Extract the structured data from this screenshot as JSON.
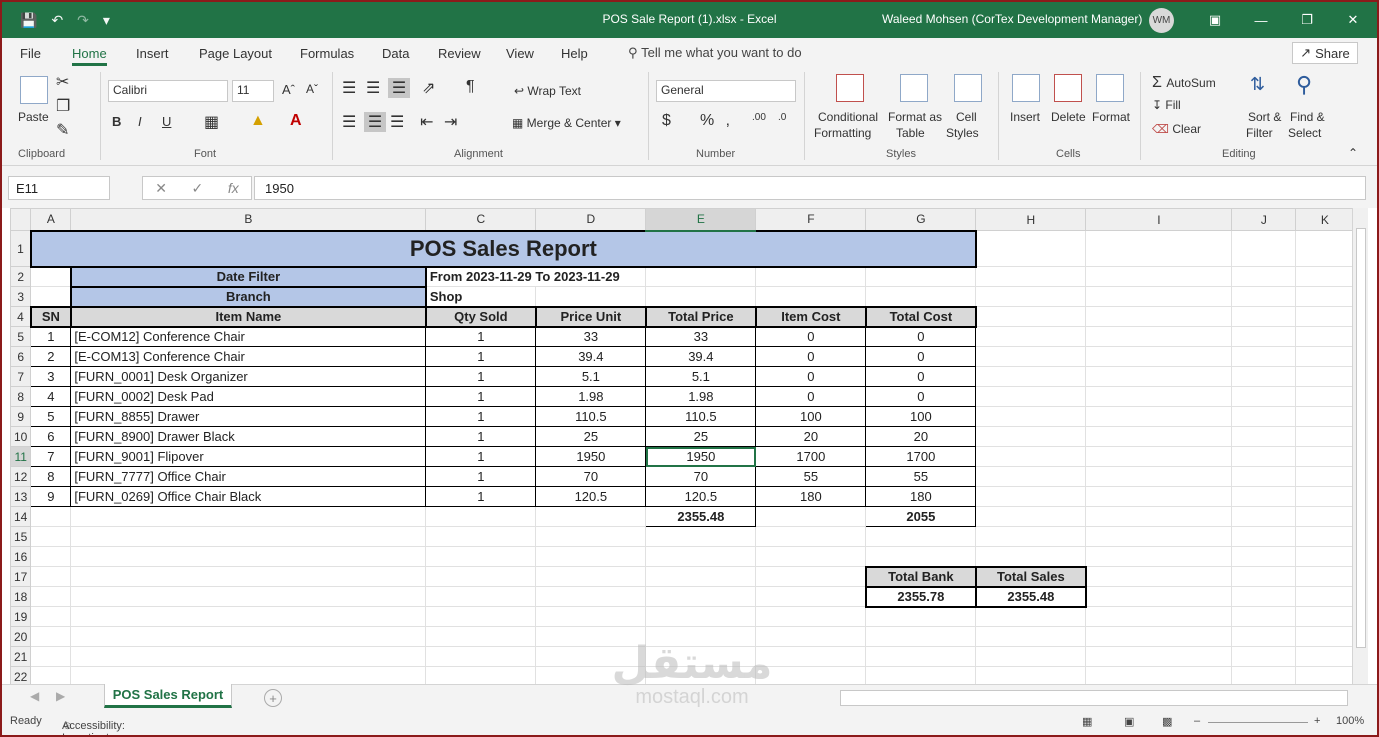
{
  "titlebar": {
    "title": "POS Sale Report (1).xlsx  -  Excel",
    "user": "Waleed Mohsen (CorTex Development Manager)",
    "avatar": "WM"
  },
  "tabs": [
    "File",
    "Home",
    "Insert",
    "Page Layout",
    "Formulas",
    "Data",
    "Review",
    "View",
    "Help"
  ],
  "tell_me": "Tell me what you want to do",
  "share": "Share",
  "ribbon": {
    "clipboard": {
      "paste": "Paste",
      "label": "Clipboard"
    },
    "font": {
      "name": "Calibri",
      "size": "11",
      "label": "Font"
    },
    "alignment": {
      "wrap": "Wrap Text",
      "merge": "Merge & Center",
      "label": "Alignment"
    },
    "number": {
      "format": "General",
      "label": "Number"
    },
    "styles": {
      "conditional": "Conditional",
      "conditional2": "Formatting",
      "format_as": "Format as",
      "format_as2": "Table",
      "cell": "Cell",
      "cell2": "Styles",
      "label": "Styles"
    },
    "cells": {
      "insert": "Insert",
      "delete": "Delete",
      "format": "Format",
      "label": "Cells"
    },
    "editing": {
      "autosum": "AutoSum",
      "fill": "Fill",
      "clear": "Clear",
      "sort": "Sort &",
      "sort2": "Filter",
      "find": "Find &",
      "find2": "Select",
      "label": "Editing"
    }
  },
  "formula_bar": {
    "name_box": "E11",
    "formula": "1950"
  },
  "columns": [
    "A",
    "B",
    "C",
    "D",
    "E",
    "F",
    "G",
    "H",
    "I",
    "J",
    "K"
  ],
  "report": {
    "title": "POS Sales Report",
    "date_filter_label": "Date Filter",
    "date_filter_value": "From 2023-11-29 To 2023-11-29",
    "branch_label": "Branch",
    "branch_value": "Shop",
    "headers": [
      "SN",
      "Item Name",
      "Qty Sold",
      "Price Unit",
      "Total Price",
      "Item Cost",
      "Total Cost"
    ],
    "rows": [
      [
        "1",
        "[E-COM12] Conference Chair",
        "1",
        "33",
        "33",
        "0",
        "0"
      ],
      [
        "2",
        "[E-COM13] Conference Chair",
        "1",
        "39.4",
        "39.4",
        "0",
        "0"
      ],
      [
        "3",
        "[FURN_0001] Desk Organizer",
        "1",
        "5.1",
        "5.1",
        "0",
        "0"
      ],
      [
        "4",
        "[FURN_0002] Desk Pad",
        "1",
        "1.98",
        "1.98",
        "0",
        "0"
      ],
      [
        "5",
        "[FURN_8855] Drawer",
        "1",
        "110.5",
        "110.5",
        "100",
        "100"
      ],
      [
        "6",
        "[FURN_8900] Drawer Black",
        "1",
        "25",
        "25",
        "20",
        "20"
      ],
      [
        "7",
        "[FURN_9001] Flipover",
        "1",
        "1950",
        "1950",
        "1700",
        "1700"
      ],
      [
        "8",
        "[FURN_7777] Office Chair",
        "1",
        "70",
        "70",
        "55",
        "55"
      ],
      [
        "9",
        "[FURN_0269] Office Chair Black",
        "1",
        "120.5",
        "120.5",
        "180",
        "180"
      ]
    ],
    "total_price": "2355.48",
    "total_cost": "2055",
    "total_bank_label": "Total Bank",
    "total_sales_label": "Total Sales",
    "total_bank": "2355.78",
    "total_sales": "2355.48"
  },
  "sheet_tab": "POS Sales Report",
  "status": {
    "ready": "Ready",
    "accessibility": "Accessibility: Investigate",
    "zoom": "100%"
  },
  "watermark": {
    "arabic": "مستقل",
    "latin": "mostaql.com"
  }
}
